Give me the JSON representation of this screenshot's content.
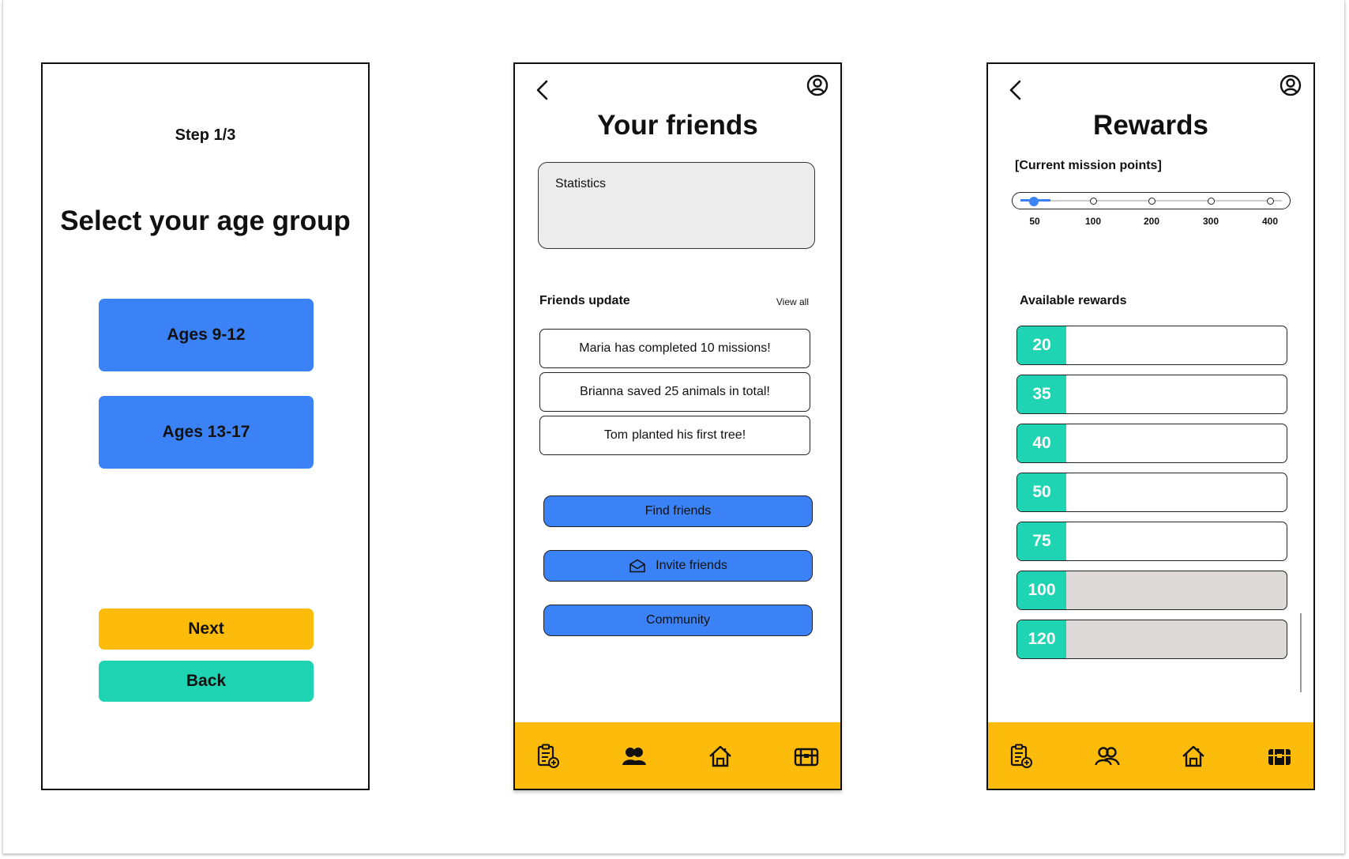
{
  "screen1": {
    "step": "Step 1/3",
    "title": "Select your age group",
    "age_options": [
      "Ages 9-12",
      "Ages 13-17"
    ],
    "next_label": "Next",
    "back_label": "Back",
    "colors": {
      "age_button": "#3b82f6",
      "next": "#fdbc0c",
      "back": "#1ed4b2"
    }
  },
  "screen2": {
    "title": "Your friends",
    "stats_label": "Statistics",
    "friends_update_label": "Friends update",
    "view_all": "View all",
    "updates": [
      {
        "name": "Maria",
        "text": "has completed 10 missions!"
      },
      {
        "name": "Brianna",
        "text": "saved 25 animals in total!"
      },
      {
        "name": "Tom",
        "text": "planted his first tree!"
      }
    ],
    "buttons": {
      "find": "Find friends",
      "invite": "Invite friends",
      "community": "Community"
    },
    "nav": [
      "clipboard-add-icon",
      "friends-icon",
      "home-icon",
      "treasure-chest-icon"
    ],
    "active_nav": "friends-icon"
  },
  "screen3": {
    "title": "Rewards",
    "mission_points_label": "[Current mission points]",
    "slider_ticks": [
      "50",
      "100",
      "200",
      "300",
      "400"
    ],
    "slider_value": 50,
    "available_label": "Available rewards",
    "rewards": [
      {
        "value": "20",
        "locked": false
      },
      {
        "value": "35",
        "locked": false
      },
      {
        "value": "40",
        "locked": false
      },
      {
        "value": "50",
        "locked": false
      },
      {
        "value": "75",
        "locked": false
      },
      {
        "value": "100",
        "locked": true
      },
      {
        "value": "120",
        "locked": true
      }
    ],
    "nav": [
      "clipboard-add-icon",
      "friends-icon",
      "home-icon",
      "treasure-chest-icon"
    ],
    "active_nav": "treasure-chest-icon"
  },
  "colors": {
    "accent_blue": "#3b82f6",
    "accent_yellow": "#fdbc0c",
    "accent_teal": "#1ed4b2",
    "locked_grey": "#dcd9d8"
  }
}
